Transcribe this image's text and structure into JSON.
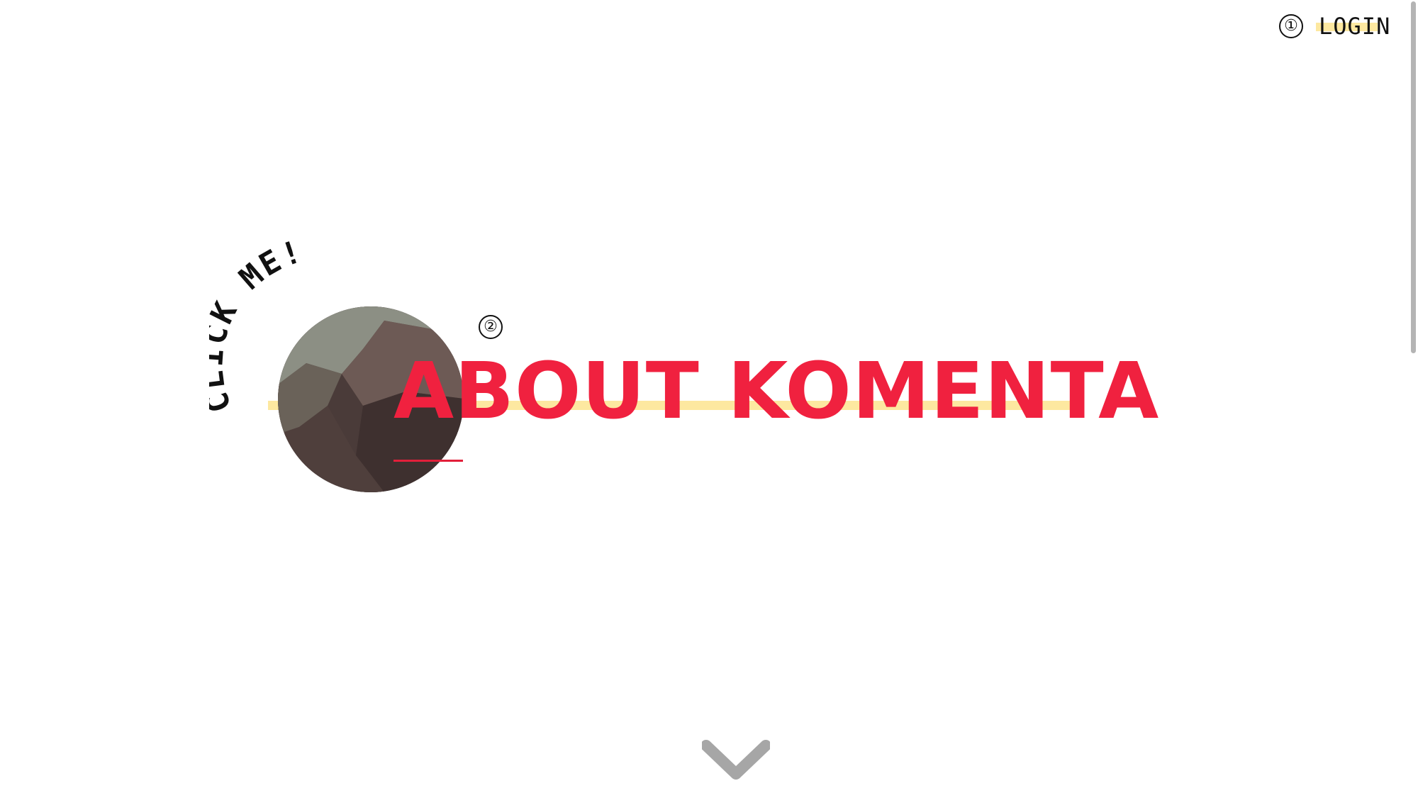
{
  "header": {
    "marker": "①",
    "login_label": "LOGIN"
  },
  "hero": {
    "click_me_label": "CLICK ME!",
    "marker": "②",
    "title": "ABOUT KOMENTA"
  },
  "icons": {
    "scroll_down": "chevron-down-icon"
  },
  "colors": {
    "accent": "#f0213f",
    "highlight": "#fde8a0",
    "chevron": "#a6a6a6"
  }
}
